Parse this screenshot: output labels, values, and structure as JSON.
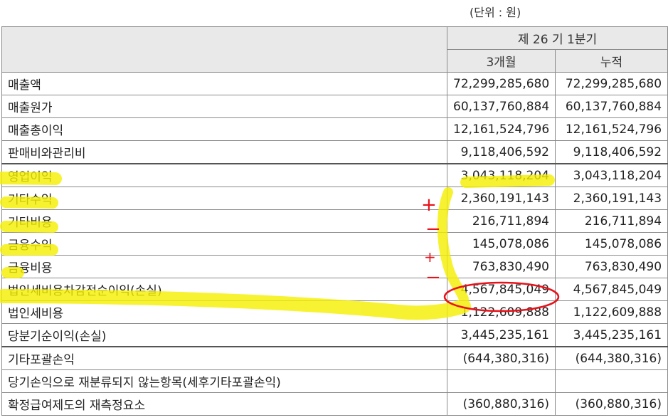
{
  "unit": "(단위 : 원)",
  "header": {
    "period": "제 26 기 1분기",
    "col_quarter": "3개월",
    "col_cumulative": "누적"
  },
  "rows": [
    {
      "label": "매출액",
      "q": "72,299,285,680",
      "c": "72,299,285,680"
    },
    {
      "label": "매출원가",
      "q": "60,137,760,884",
      "c": "60,137,760,884"
    },
    {
      "label": "매출총이익",
      "q": "12,161,524,796",
      "c": "12,161,524,796"
    },
    {
      "label": "판매비와관리비",
      "q": "9,118,406,592",
      "c": "9,118,406,592"
    },
    {
      "label": "영업이익",
      "q": "3,043,118,204",
      "c": "3,043,118,204"
    },
    {
      "label": "기타수익",
      "q": "2,360,191,143",
      "c": "2,360,191,143"
    },
    {
      "label": "기타비용",
      "q": "216,711,894",
      "c": "216,711,894"
    },
    {
      "label": "금융수익",
      "q": "145,078,086",
      "c": "145,078,086"
    },
    {
      "label": "금융비용",
      "q": "763,830,490",
      "c": "763,830,490"
    },
    {
      "label": "법인세비용차감전순이익(손실)",
      "q": "4,567,845,049",
      "c": "4,567,845,049"
    },
    {
      "label": "법인세비용",
      "q": "1,122,609,888",
      "c": "1,122,609,888"
    },
    {
      "label": "당분기순이익(손실)",
      "q": "3,445,235,161",
      "c": "3,445,235,161"
    },
    {
      "label": "기타포괄손익",
      "q": "(644,380,316)",
      "c": "(644,380,316)"
    },
    {
      "label": "당기손익으로 재분류되지 않는항목(세후기타포괄손익)",
      "q": "",
      "c": ""
    },
    {
      "label": "확정급여제도의 재측정요소",
      "q": "(360,880,316)",
      "c": "(360,880,316)"
    }
  ],
  "annotations": {
    "plus_mark": "+",
    "minus_mark": "−",
    "highlight_color": "#f5f000",
    "pen_color": "#e8121a"
  }
}
